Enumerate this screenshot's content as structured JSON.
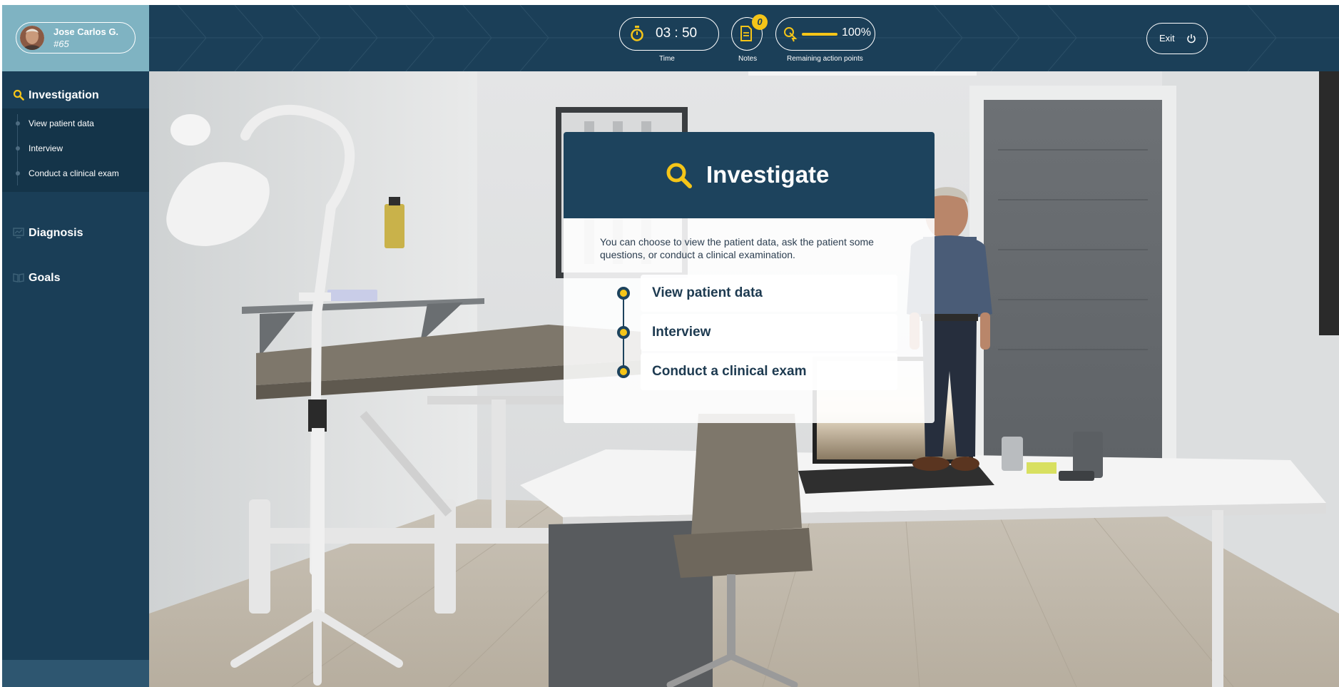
{
  "patient": {
    "name": "Jose Carlos G.",
    "id": "#65"
  },
  "sidebar": {
    "sections": [
      {
        "label": "Investigation",
        "icon": "magnifier-icon",
        "active": true,
        "items": [
          {
            "label": "View patient data"
          },
          {
            "label": "Interview"
          },
          {
            "label": "Conduct a clinical exam"
          }
        ]
      },
      {
        "label": "Diagnosis",
        "icon": "monitor-chart-icon"
      },
      {
        "label": "Goals",
        "icon": "open-book-icon"
      }
    ]
  },
  "hud": {
    "time_value": "03 : 50",
    "time_label": "Time",
    "notes_label": "Notes",
    "notes_count": "0",
    "action_points_value": "100%",
    "action_points_fraction": 1.0,
    "action_points_label": "Remaining action points",
    "exit_label": "Exit"
  },
  "dialog": {
    "title": "Investigate",
    "icon": "magnifier-icon",
    "description": "You can choose to view the patient data, ask the patient some questions, or conduct a clinical examination.",
    "options": [
      {
        "label": "View patient data"
      },
      {
        "label": "Interview"
      },
      {
        "label": "Conduct a clinical exam"
      }
    ]
  },
  "colors": {
    "navy": "#1b3f58",
    "accent_yellow": "#f5c518",
    "patient_panel": "#7fb3c2"
  }
}
